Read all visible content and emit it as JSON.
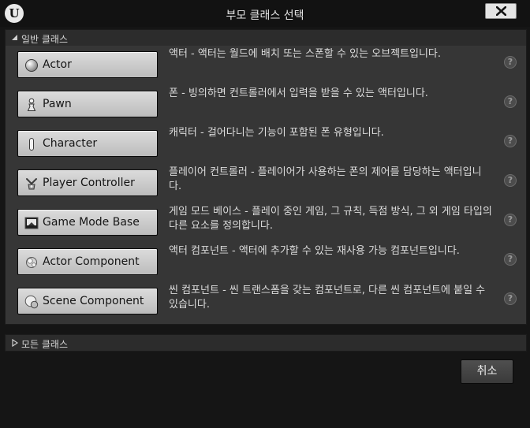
{
  "window": {
    "title": "부모 클래스 선택",
    "logo_text": "U"
  },
  "common_section": {
    "label": "일반 클래스",
    "items": [
      {
        "label": "Actor",
        "icon": "actor-icon",
        "description": "액터 - 액터는 월드에 배치 또는 스폰할 수 있는 오브젝트입니다."
      },
      {
        "label": "Pawn",
        "icon": "pawn-icon",
        "description": "폰 - 빙의하면 컨트롤러에서 입력을 받을 수 있는 액터입니다."
      },
      {
        "label": "Character",
        "icon": "character-icon",
        "description": "캐릭터 - 걸어다니는 기능이 포함된 폰 유형입니다."
      },
      {
        "label": "Player Controller",
        "icon": "player-controller-icon",
        "description": "플레이어 컨트롤러 - 플레이어가 사용하는 폰의 제어를 담당하는 액터입니다."
      },
      {
        "label": "Game Mode Base",
        "icon": "game-mode-icon",
        "description": "게임 모드 베이스 - 플레이 중인 게임, 그 규칙, 득점 방식, 그 외 게임 타입의 다른 요소를 정의합니다."
      },
      {
        "label": "Actor Component",
        "icon": "actor-component-icon",
        "description": "액터 컴포넌트 - 액터에 추가할 수 있는 재사용 가능 컴포넌트입니다."
      },
      {
        "label": "Scene Component",
        "icon": "scene-component-icon",
        "description": "씬 컴포넌트 - 씬 트랜스폼을 갖는 컴포넌트로, 다른 씬 컴포넌트에 붙일 수 있습니다."
      }
    ],
    "help_glyph": "?"
  },
  "all_section": {
    "label": "모든 클래스"
  },
  "footer": {
    "cancel_label": "취소"
  },
  "colors": {
    "background": "#151515",
    "panel": "#363636",
    "button_face": "#c8c8c8"
  }
}
